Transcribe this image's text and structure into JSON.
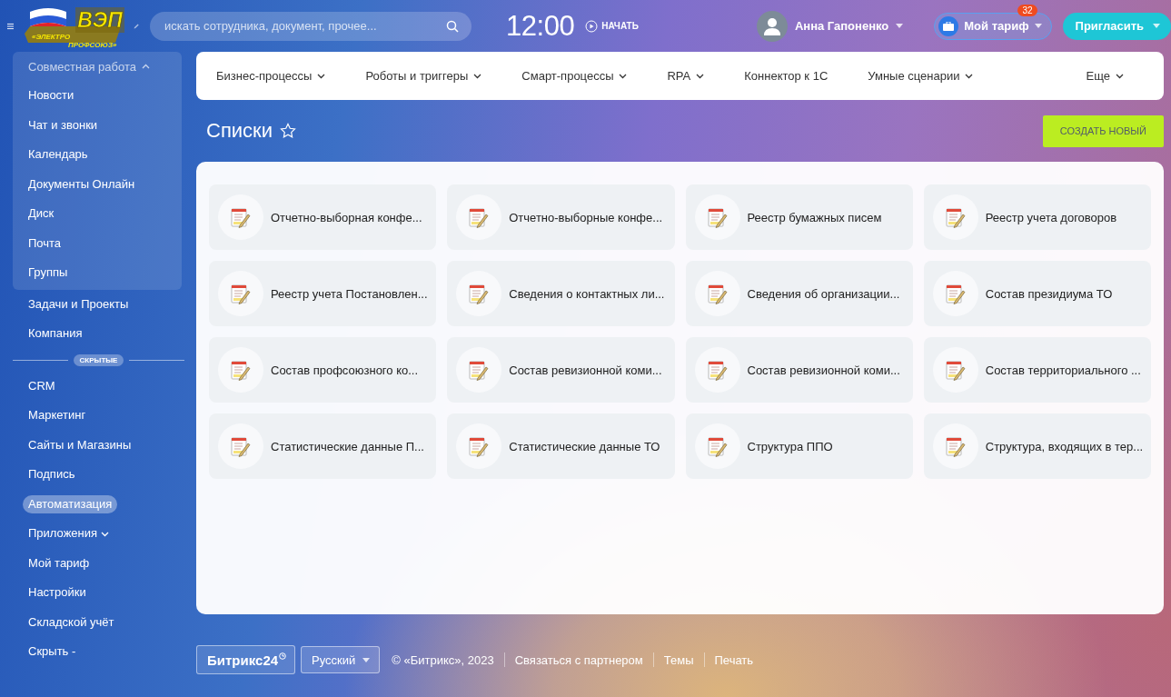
{
  "header": {
    "logo": {
      "mark": "ВЭП",
      "line1": "«ЭЛЕКТРО",
      "line2": "ПРОФСОЮЗ»"
    },
    "search": {
      "placeholder": "искать сотрудника, документ, прочее..."
    },
    "time": "12:00",
    "start_label": "НАЧАТЬ",
    "user_name": "Анна Гапоненко",
    "tariff": {
      "label": "Мой тариф",
      "badge": "32"
    },
    "invite_label": "Пригласить"
  },
  "sidebar": {
    "section": {
      "label": "Совместная работа",
      "expanded": true,
      "children": [
        {
          "label": "Новости",
          "selected": false
        },
        {
          "label": "Чат и звонки",
          "selected": false
        },
        {
          "label": "Календарь",
          "selected": false
        },
        {
          "label": "Документы Онлайн",
          "selected": false
        },
        {
          "label": "Диск",
          "selected": false
        },
        {
          "label": "Почта",
          "selected": false
        },
        {
          "label": "Группы",
          "selected": false
        }
      ]
    },
    "items": [
      {
        "label": "Задачи и Проекты",
        "selected": false
      },
      {
        "label": "Компания",
        "selected": false
      }
    ],
    "hidden_label": "СКРЫТЫЕ",
    "hidden_items": [
      {
        "label": "CRM",
        "selected": false,
        "kind": "link"
      },
      {
        "label": "Маркетинг",
        "selected": false,
        "kind": "link"
      },
      {
        "label": "Сайты и Магазины",
        "selected": false,
        "kind": "link"
      },
      {
        "label": "Подпись",
        "selected": false,
        "kind": "link"
      },
      {
        "label": "Автоматизация",
        "selected": true,
        "kind": "link"
      },
      {
        "label": "Приложения",
        "selected": false,
        "kind": "menu"
      },
      {
        "label": "Мой тариф",
        "selected": false,
        "kind": "link"
      },
      {
        "label": "Настройки",
        "selected": false,
        "kind": "link"
      },
      {
        "label": "Складской учёт",
        "selected": false,
        "kind": "link"
      },
      {
        "label": "Скрыть -",
        "selected": false,
        "kind": "link"
      }
    ]
  },
  "nav_tabs": [
    {
      "label": "Бизнес-процессы",
      "dropdown": true
    },
    {
      "label": "Роботы и триггеры",
      "dropdown": true
    },
    {
      "label": "Смарт-процессы",
      "dropdown": true
    },
    {
      "label": "RPA",
      "dropdown": true
    },
    {
      "label": "Коннектор к 1С",
      "dropdown": false
    },
    {
      "label": "Умные сценарии",
      "dropdown": true
    },
    {
      "label": "Еще",
      "dropdown": true
    }
  ],
  "page_title": "Списки",
  "create_button": "СОЗДАТЬ НОВЫЙ",
  "lists": [
    "Отчетно-выборная конфе...",
    "Отчетно-выборные конфе...",
    "Реестр бумажных писем",
    "Реестр учета договоров",
    "Реестр учета Постановлен...",
    "Сведения о контактных ли...",
    "Сведения об организации...",
    "Состав президиума ТО",
    "Состав профсоюзного ко...",
    "Состав ревизионной коми...",
    "Состав ревизионной коми...",
    "Состав территориального ...",
    "Статистические данные П...",
    "Статистические данные ТО",
    "Структура ППО",
    "Структура, входящих в тер..."
  ],
  "footer": {
    "brand": "Битрикс24",
    "language": "Русский",
    "copyright": "© «Битрикс», 2023",
    "links": [
      "Связаться с партнером",
      "Темы",
      "Печать"
    ]
  }
}
